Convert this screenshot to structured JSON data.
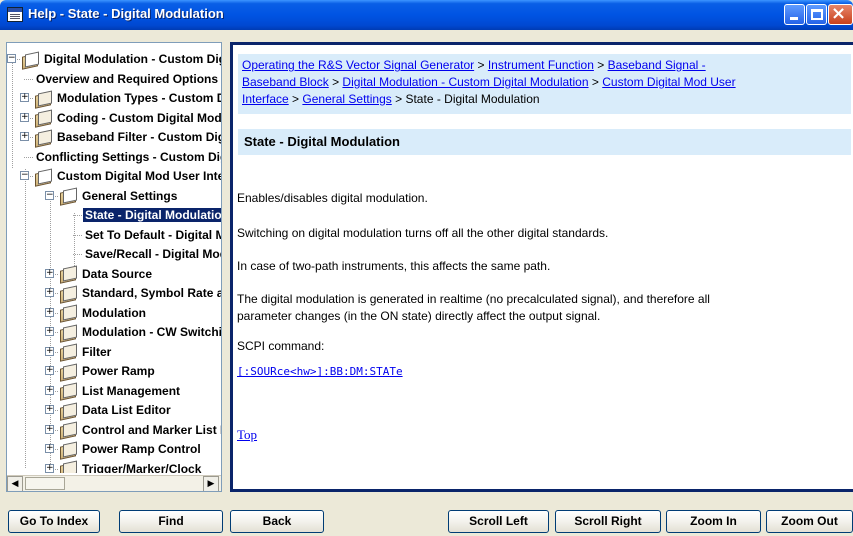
{
  "window": {
    "title": "Help -  State - Digital Modulation"
  },
  "tree": {
    "items": [
      {
        "label": "Digital Modulation - Custom Digital Modulation",
        "level": 0,
        "expander": "−",
        "icon": "book-open-icon"
      },
      {
        "label": "Overview and Required Options",
        "level": 1,
        "expander": "",
        "icon": ""
      },
      {
        "label": "Modulation Types - Custom Digital Modulation",
        "level": 1,
        "expander": "+",
        "icon": "book-icon"
      },
      {
        "label": "Coding - Custom Digital Modulation",
        "level": 1,
        "expander": "+",
        "icon": "book-icon"
      },
      {
        "label": "Baseband Filter - Custom Digital Modulation",
        "level": 1,
        "expander": "+",
        "icon": "book-icon"
      },
      {
        "label": "Conflicting Settings - Custom Digital Modulation",
        "level": 1,
        "expander": "",
        "icon": ""
      },
      {
        "label": "Custom Digital Mod User Interface",
        "level": 1,
        "expander": "−",
        "icon": "book-open-icon"
      },
      {
        "label": "General Settings",
        "level": 2,
        "expander": "−",
        "icon": "book-open-icon"
      },
      {
        "label": "State - Digital Modulation",
        "level": 3,
        "expander": "",
        "icon": "",
        "selected": true
      },
      {
        "label": "Set To Default - Digital Modulation",
        "level": 3,
        "expander": "",
        "icon": ""
      },
      {
        "label": "Save/Recall - Digital Modulation",
        "level": 3,
        "expander": "",
        "icon": ""
      },
      {
        "label": "Data Source",
        "level": 2,
        "expander": "+",
        "icon": "book-icon"
      },
      {
        "label": "Standard, Symbol Rate and Coding",
        "level": 2,
        "expander": "+",
        "icon": "book-icon"
      },
      {
        "label": "Modulation",
        "level": 2,
        "expander": "+",
        "icon": "book-icon"
      },
      {
        "label": "Modulation - CW Switching",
        "level": 2,
        "expander": "+",
        "icon": "book-icon"
      },
      {
        "label": "Filter",
        "level": 2,
        "expander": "+",
        "icon": "book-icon"
      },
      {
        "label": "Power Ramp",
        "level": 2,
        "expander": "+",
        "icon": "book-icon"
      },
      {
        "label": "List Management",
        "level": 2,
        "expander": "+",
        "icon": "book-icon"
      },
      {
        "label": "Data List Editor",
        "level": 2,
        "expander": "+",
        "icon": "book-icon"
      },
      {
        "label": "Control and Marker List Editor",
        "level": 2,
        "expander": "+",
        "icon": "book-icon"
      },
      {
        "label": "Power Ramp Control",
        "level": 2,
        "expander": "+",
        "icon": "book-icon"
      },
      {
        "label": "Trigger/Marker/Clock",
        "level": 2,
        "expander": "+",
        "icon": "book-icon"
      }
    ]
  },
  "breadcrumb": {
    "link1": "Operating the R&S Vector Signal Generator",
    "sep1": " > ",
    "link2": "Instrument Function",
    "sep2": " > ",
    "link3a": "Baseband Signal -",
    "link3b": "Baseband Block",
    "sep3": " > ",
    "link4": "Digital Modulation - Custom Digital Modulation",
    "sep4": " > ",
    "link5a": "Custom Digital Mod User",
    "link5b": "Interface",
    "sep5": " > ",
    "link6": "General Settings",
    "sep6": " > ",
    "current": "State - Digital Modulation"
  },
  "content": {
    "heading": "State - Digital Modulation",
    "p1": "Enables/disables digital modulation.",
    "p2": "Switching on digital modulation turns off all the other digital standards.",
    "p3": "In case of two-path instruments, this affects the same path.",
    "p4a": "The digital modulation is generated in realtime (no precalculated signal), and therefore all",
    "p4b": "parameter changes (in the ON state) directly affect the output signal.",
    "scpi_label": "SCPI command:",
    "scpi_command": "[:SOURce<hw>]:BB:DM:STATe",
    "top_link": "Top"
  },
  "buttons": {
    "go_to_index": "Go To Index",
    "find": "Find",
    "back": "Back",
    "scroll_left": "Scroll Left",
    "scroll_right": "Scroll Right",
    "zoom_in": "Zoom In",
    "zoom_out": "Zoom Out"
  },
  "colors": {
    "titlebar": "#0054e3",
    "selection": "#0a246a",
    "link": "#0000ee",
    "panel_bg": "#d9ecfa"
  }
}
